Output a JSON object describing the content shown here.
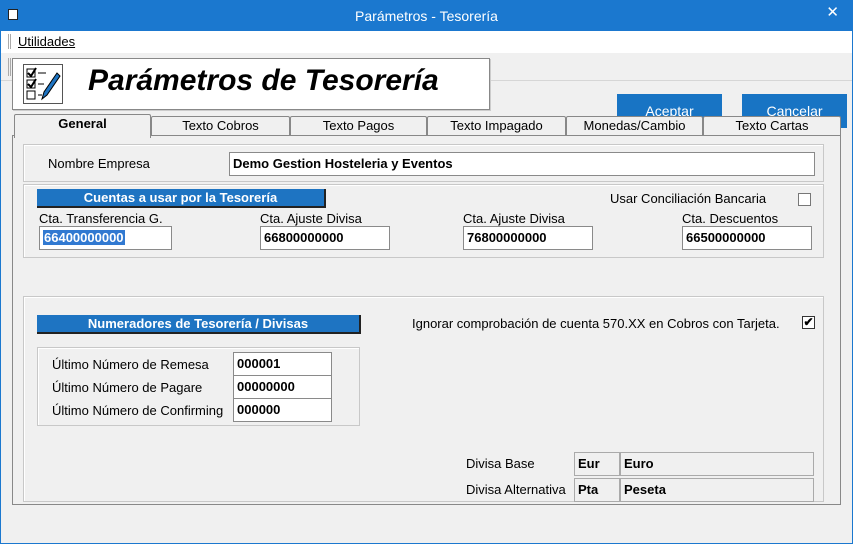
{
  "window": {
    "title": "Parámetros - Tesorería",
    "close_glyph": "✕"
  },
  "menubar": {
    "utilidades": "Utilidades"
  },
  "toolbar": {
    "icons": [
      "exit-icon",
      "document-icon",
      "eye-icon",
      "stamp-icon",
      "binoculars-icon"
    ]
  },
  "header": {
    "title": "Parámetros de Tesorería"
  },
  "buttons": {
    "accept": "Aceptar",
    "cancel": "Cancelar"
  },
  "tabs": [
    "General",
    "Texto Cobros",
    "Texto Pagos",
    "Texto Impagado",
    "Monedas/Cambio",
    "Texto Cartas"
  ],
  "empresa": {
    "label": "Nombre Empresa",
    "value": "Demo Gestion Hosteleria y Eventos"
  },
  "cuentas": {
    "banner": "Cuentas a usar por la Tesorería",
    "conciliacion_label": "Usar Conciliación Bancaria",
    "conciliacion_checked": false,
    "fields": [
      {
        "label": "Cta. Transferencia G.",
        "value": "66400000000"
      },
      {
        "label": "Cta. Ajuste Divisa",
        "value": "66800000000"
      },
      {
        "label": "Cta. Ajuste Divisa",
        "value": "76800000000"
      },
      {
        "label": "Cta. Descuentos",
        "value": "66500000000"
      }
    ]
  },
  "numeradores": {
    "banner": "Numeradores de Tesorería / Divisas",
    "ignorar_label": "Ignorar comprobación de cuenta 570.XX en Cobros con Tarjeta.",
    "ignorar_checked": true,
    "check_glyph": "✔",
    "rows": [
      {
        "label": "Último Número de Remesa",
        "value": "000001"
      },
      {
        "label": "Último Número de Pagare",
        "value": "00000000"
      },
      {
        "label": "Último Número de Confirming",
        "value": "000000"
      }
    ]
  },
  "divisas": {
    "base": {
      "label": "Divisa Base",
      "code": "Eur",
      "name": "Euro"
    },
    "alternativa": {
      "label": "Divisa Alternativa",
      "code": "Pta",
      "name": "Peseta"
    }
  }
}
